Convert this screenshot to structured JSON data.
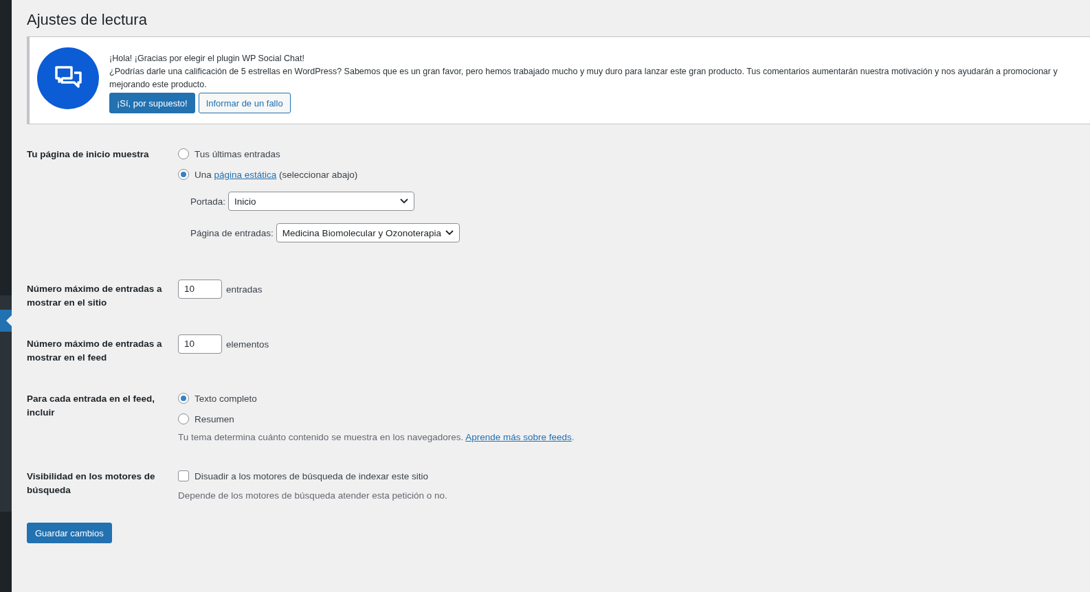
{
  "page_title": "Ajustes de lectura",
  "notice": {
    "lines": [
      "¡Hola! ¡Gracias por elegir el plugin WP Social Chat!",
      "¿Podrías darle una calificación de 5 estrellas en WordPress? Sabemos que es un gran favor, pero hemos trabajado mucho y muy duro para lanzar este gran producto. Tus comentarios aumentarán nuestra motivación y nos ayudarán a promocionar y",
      "mejorando este producto."
    ],
    "buttons": [
      {
        "label": "¡Sí, por supuesto!",
        "kind": "primary"
      },
      {
        "label": "Informar de un fallo",
        "kind": "secondary"
      }
    ]
  },
  "settings": [
    {
      "kind": "radio-group",
      "label": "Tu página de inicio muestra",
      "options": [
        {
          "text": "Tus últimas entradas",
          "selected": false
        },
        {
          "text": "Una",
          "link": "página estática",
          "text_after": "(seleccionar abajo)",
          "selected": true
        }
      ],
      "selects": [
        {
          "label": "Portada:",
          "value": "Inicio"
        },
        {
          "label": "Página de entradas:",
          "value": "Medicina Biomolecular y Ozonoterapia"
        }
      ]
    },
    {
      "kind": "number",
      "label": "Número máximo de entradas a mostrar en el sitio",
      "value": "10",
      "unit": "entradas"
    },
    {
      "kind": "number",
      "label": "Número máximo de entradas a mostrar en el feed",
      "value": "10",
      "unit": "elementos"
    },
    {
      "kind": "radio-group",
      "label": "Para cada entrada en el feed, incluir",
      "options": [
        {
          "text": "Texto completo",
          "selected": true
        },
        {
          "text": "Resumen",
          "selected": false
        }
      ],
      "description": {
        "text": "Tu tema determina cuánto contenido se muestra en los navegadores.",
        "link": "Aprende más sobre feeds",
        "text_after": "."
      }
    },
    {
      "kind": "checkbox",
      "label": "Visibilidad en los motores de búsqueda",
      "text": "Disuadir a los motores de búsqueda de indexar este sitio",
      "checked": false,
      "description": {
        "text": "Depende de los motores de búsqueda atender esta petición o no."
      }
    }
  ],
  "save_button": "Guardar cambios"
}
